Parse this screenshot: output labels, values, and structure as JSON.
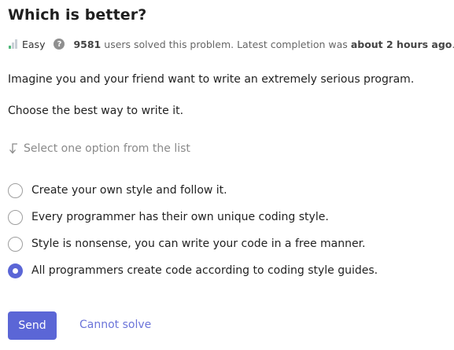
{
  "problem": {
    "title": "Which is better?",
    "difficulty": "Easy",
    "solved_count": "9581",
    "solved_text": "users solved this problem. Latest completion was",
    "latest_time": "about 2 hours ago",
    "latest_period": "."
  },
  "description": {
    "paragraph1": "Imagine you and your friend want to write an extremely serious program.",
    "paragraph2": "Choose the best way to write it."
  },
  "instruction": {
    "text": "Select one option from the list",
    "icon": "arrow-down-left-icon"
  },
  "options": [
    {
      "label": "Create your own style and follow it.",
      "selected": false
    },
    {
      "label": "Every programmer has their own unique coding style.",
      "selected": false
    },
    {
      "label": "Style is nonsense, you can write your code in a free manner.",
      "selected": false
    },
    {
      "label": "All programmers create code according to coding style guides.",
      "selected": true
    }
  ],
  "actions": {
    "send_label": "Send",
    "cannot_solve_label": "Cannot solve"
  },
  "colors": {
    "accent": "#5b66d6",
    "link": "#6b74d9",
    "difficulty_easy": "#4fb87a"
  }
}
